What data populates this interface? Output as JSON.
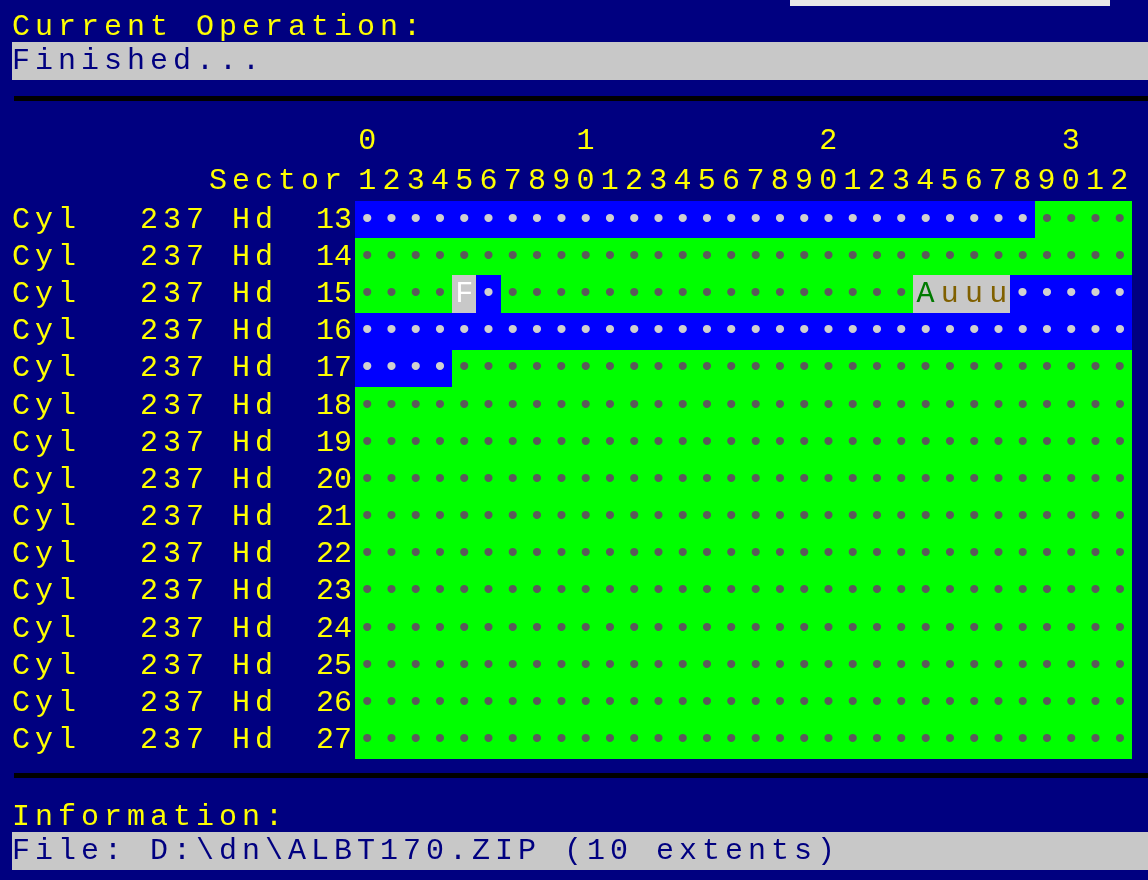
{
  "operation": {
    "label": "Current Operation:",
    "value": "Finished..."
  },
  "map": {
    "sector_label": "Sector",
    "tens": [
      "0",
      "1",
      "2",
      "3"
    ],
    "units": "12345678901234567890123456789012",
    "rows": [
      {
        "cyl_label": "Cyl",
        "cyl": "237",
        "hd_label": "Hd",
        "hd": "13",
        "segments": [
          {
            "text": "••••••••••••••••••••••••••••",
            "kind": "used",
            "color": "#0000ff"
          },
          {
            "text": "••••",
            "kind": "free",
            "color": "#00ff00"
          }
        ]
      },
      {
        "cyl_label": "Cyl",
        "cyl": "237",
        "hd_label": "Hd",
        "hd": "14",
        "segments": [
          {
            "text": "••••••••••••••••••••••••••••••••",
            "kind": "free",
            "color": "#00ff00"
          }
        ]
      },
      {
        "cyl_label": "Cyl",
        "cyl": "237",
        "hd_label": "Hd",
        "hd": "15",
        "segments": [
          {
            "text": "••••",
            "kind": "free",
            "color": "#00ff00"
          },
          {
            "text": "F",
            "kind": "fragment",
            "color": "#c8c8c8"
          },
          {
            "text": "•",
            "kind": "used",
            "color": "#0000ff"
          },
          {
            "text": "•••••••••••••••••",
            "kind": "free",
            "color": "#00ff00"
          },
          {
            "text": "A",
            "kind": "start",
            "color": "#c8c8c8"
          },
          {
            "text": "uuu",
            "kind": "file",
            "color": "#c8c8c8"
          },
          {
            "text": "•••••",
            "kind": "used",
            "color": "#0000ff"
          }
        ]
      },
      {
        "cyl_label": "Cyl",
        "cyl": "237",
        "hd_label": "Hd",
        "hd": "16",
        "segments": [
          {
            "text": "••••••••••••••••••••••••••••••••",
            "kind": "used",
            "color": "#0000ff"
          }
        ]
      },
      {
        "cyl_label": "Cyl",
        "cyl": "237",
        "hd_label": "Hd",
        "hd": "17",
        "segments": [
          {
            "text": "••••",
            "kind": "used",
            "color": "#0000ff"
          },
          {
            "text": "••••••••••••••••••••••••••••",
            "kind": "free",
            "color": "#00ff00"
          }
        ]
      },
      {
        "cyl_label": "Cyl",
        "cyl": "237",
        "hd_label": "Hd",
        "hd": "18",
        "segments": [
          {
            "text": "••••••••••••••••••••••••••••••••",
            "kind": "free",
            "color": "#00ff00"
          }
        ]
      },
      {
        "cyl_label": "Cyl",
        "cyl": "237",
        "hd_label": "Hd",
        "hd": "19",
        "segments": [
          {
            "text": "••••••••••••••••••••••••••••••••",
            "kind": "free",
            "color": "#00ff00"
          }
        ]
      },
      {
        "cyl_label": "Cyl",
        "cyl": "237",
        "hd_label": "Hd",
        "hd": "20",
        "segments": [
          {
            "text": "••••••••••••••••••••••••••••••••",
            "kind": "free",
            "color": "#00ff00"
          }
        ]
      },
      {
        "cyl_label": "Cyl",
        "cyl": "237",
        "hd_label": "Hd",
        "hd": "21",
        "segments": [
          {
            "text": "••••••••••••••••••••••••••••••••",
            "kind": "free",
            "color": "#00ff00"
          }
        ]
      },
      {
        "cyl_label": "Cyl",
        "cyl": "237",
        "hd_label": "Hd",
        "hd": "22",
        "segments": [
          {
            "text": "••••••••••••••••••••••••••••••••",
            "kind": "free",
            "color": "#00ff00"
          }
        ]
      },
      {
        "cyl_label": "Cyl",
        "cyl": "237",
        "hd_label": "Hd",
        "hd": "23",
        "segments": [
          {
            "text": "••••••••••••••••••••••••••••••••",
            "kind": "free",
            "color": "#00ff00"
          }
        ]
      },
      {
        "cyl_label": "Cyl",
        "cyl": "237",
        "hd_label": "Hd",
        "hd": "24",
        "segments": [
          {
            "text": "••••••••••••••••••••••••••••••••",
            "kind": "free",
            "color": "#00ff00"
          }
        ]
      },
      {
        "cyl_label": "Cyl",
        "cyl": "237",
        "hd_label": "Hd",
        "hd": "25",
        "segments": [
          {
            "text": "••••••••••••••••••••••••••••••••",
            "kind": "free",
            "color": "#00ff00"
          }
        ]
      },
      {
        "cyl_label": "Cyl",
        "cyl": "237",
        "hd_label": "Hd",
        "hd": "26",
        "segments": [
          {
            "text": "••••••••••••••••••••••••••••••••",
            "kind": "free",
            "color": "#00ff00"
          }
        ]
      },
      {
        "cyl_label": "Cyl",
        "cyl": "237",
        "hd_label": "Hd",
        "hd": "27",
        "segments": [
          {
            "text": "••••••••••••••••••••••••••••••••",
            "kind": "free",
            "color": "#00ff00"
          }
        ]
      }
    ]
  },
  "information": {
    "label": "Information:",
    "value": "File: D:\\dn\\ALBT170.ZIP (10 extents)"
  }
}
